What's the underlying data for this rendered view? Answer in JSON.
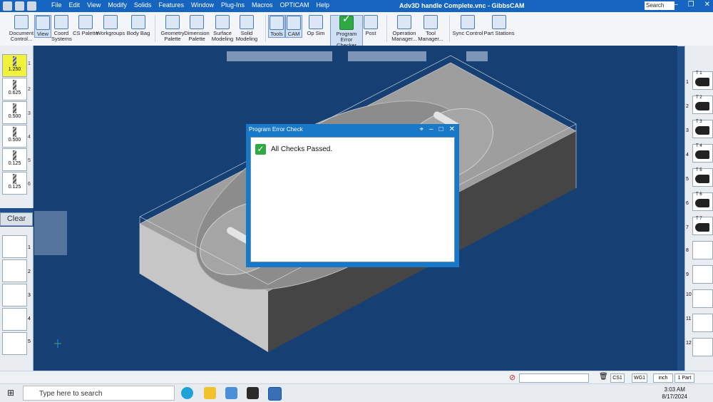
{
  "window": {
    "title": "Adv3D handle Complete.vnc - GibbsCAM",
    "search_placeholder": "Search"
  },
  "menu": [
    "File",
    "Edit",
    "View",
    "Modify",
    "Solids",
    "Features",
    "Window",
    "Plug-Ins",
    "Macros",
    "OPTICAM",
    "Help"
  ],
  "ribbon": {
    "document_control": "Document Control...",
    "view": "View",
    "coord_systems": "Coord Systems",
    "cs_palette": "CS Palette",
    "workgroups": "Workgroups",
    "body_bag": "Body Bag",
    "geometry_palette": "Geometry Palette",
    "dimension_palette": "Dimension Palette",
    "surface_modeling": "Surface Modeling",
    "solid_modeling": "Solid Modeling",
    "tools": "Tools",
    "cam": "CAM",
    "op_sim": "Op Sim",
    "program_error_checker": "Program Error Checker",
    "post": "Post",
    "operation_manager": "Operation Manager...",
    "tool_manager": "Tool Manager...",
    "sync_control": "Sync Control",
    "part_stations": "Part Stations"
  },
  "tools_left": [
    {
      "num": "1",
      "size": "1.250"
    },
    {
      "num": "2",
      "size": "0.625"
    },
    {
      "num": "3",
      "size": "0.500"
    },
    {
      "num": "4",
      "size": "0.500"
    },
    {
      "num": "5",
      "size": "0.125"
    },
    {
      "num": "6",
      "size": "0.125"
    }
  ],
  "clear_label": "Clear",
  "ops_left_nums": [
    "1",
    "2",
    "3",
    "4",
    "5"
  ],
  "tools_right": [
    {
      "num": "1",
      "label": "T 1"
    },
    {
      "num": "2",
      "label": "T 2"
    },
    {
      "num": "3",
      "label": "T 3"
    },
    {
      "num": "4",
      "label": "T 4"
    },
    {
      "num": "5",
      "label": "T 5"
    },
    {
      "num": "6",
      "label": "T 6"
    },
    {
      "num": "7",
      "label": "T 7"
    },
    {
      "num": "8",
      "label": ""
    },
    {
      "num": "9",
      "label": ""
    },
    {
      "num": "10",
      "label": ""
    },
    {
      "num": "11",
      "label": ""
    },
    {
      "num": "12",
      "label": ""
    }
  ],
  "dialog": {
    "title": "Program Error Check",
    "message": "All Checks Passed."
  },
  "status": {
    "cs": "CS1",
    "wg": "WG1",
    "units": "inch",
    "parts": "1 Part"
  },
  "taskbar": {
    "search": "Type here to search",
    "time": "3:03 AM",
    "date": "8/17/2024"
  },
  "colors": {
    "viewport_bg": "#163f73",
    "titlebar": "#1565c0",
    "dialog_frame": "#1979c9",
    "check_green": "#2eaa45",
    "selected_tool": "#f1f23a"
  }
}
